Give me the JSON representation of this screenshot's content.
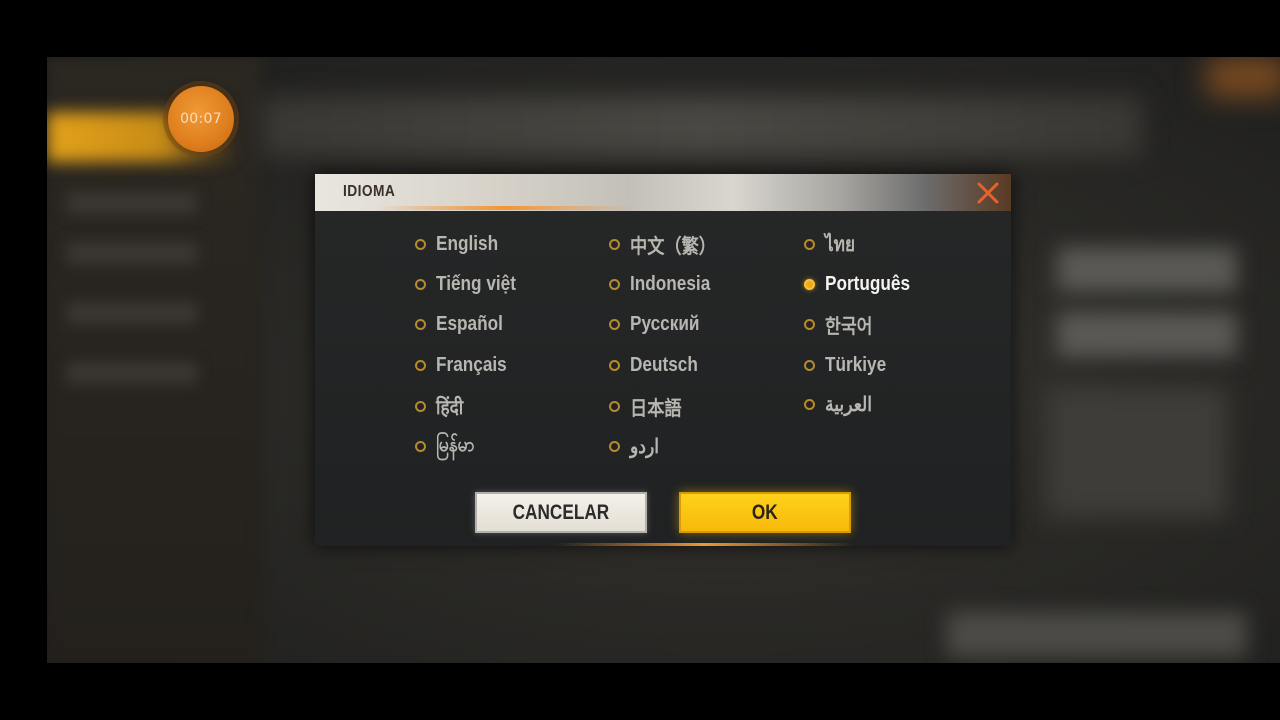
{
  "timer": {
    "label": "00:07"
  },
  "dialog": {
    "title": "IDIOMA",
    "columns": [
      [
        {
          "label": "English",
          "selected": false
        },
        {
          "label": "Tiếng việt",
          "selected": false
        },
        {
          "label": "Español",
          "selected": false
        },
        {
          "label": "Français",
          "selected": false
        },
        {
          "label": "हिंदी",
          "selected": false
        },
        {
          "label": "မြန်မာ",
          "selected": false
        }
      ],
      [
        {
          "label": "中文（繁）",
          "selected": false
        },
        {
          "label": "Indonesia",
          "selected": false
        },
        {
          "label": "Русский",
          "selected": false
        },
        {
          "label": "Deutsch",
          "selected": false
        },
        {
          "label": "日本語",
          "selected": false
        },
        {
          "label": "اردو",
          "selected": false
        }
      ],
      [
        {
          "label": "ไทย",
          "selected": false
        },
        {
          "label": "Português",
          "selected": true
        },
        {
          "label": "한국어",
          "selected": false
        },
        {
          "label": "Türkiye",
          "selected": false
        },
        {
          "label": "العربية",
          "selected": false
        }
      ]
    ],
    "cancel_label": "CANCELAR",
    "ok_label": "OK"
  },
  "colors": {
    "accent_yellow": "#f7b90b",
    "close_orange": "#e8612a",
    "radio_gold": "#b98a2a"
  },
  "icons": {
    "close": "close-icon"
  }
}
